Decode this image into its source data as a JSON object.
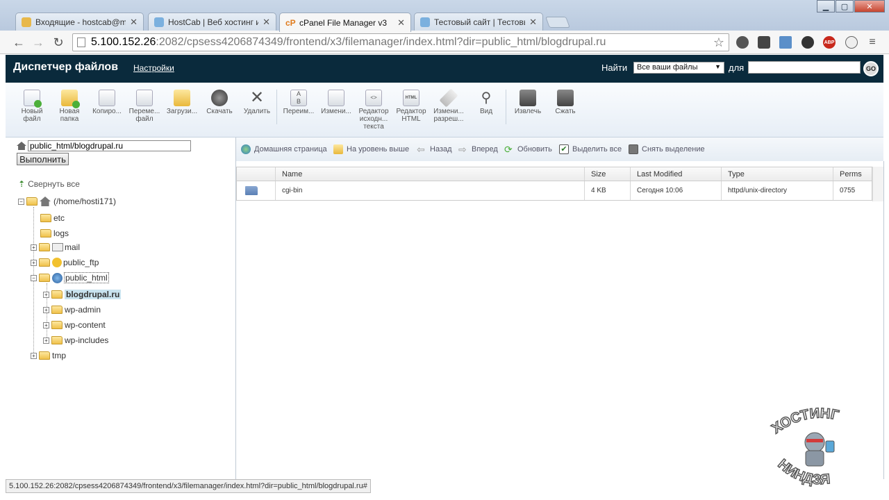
{
  "tabs": [
    {
      "label": "Входящие - hostcab@ma",
      "active": false
    },
    {
      "label": "HostCab | Веб хостинг и д",
      "active": false
    },
    {
      "label": "cPanel File Manager v3",
      "active": true
    },
    {
      "label": "Тестовый сайт | Тестовы",
      "active": false
    }
  ],
  "url": {
    "host": "5.100.152.26",
    "rest": ":2082/cpsess4206874349/frontend/x3/filemanager/index.html?dir=public_html/blogdrupal.ru"
  },
  "header": {
    "title": "Диспетчер файлов",
    "settings": "Настройки",
    "search_label": "Найти",
    "search_scope": "Все ваши файлы",
    "for_label": "для",
    "go": "GO"
  },
  "tools": [
    {
      "label": "Новый файл",
      "icon": "new-file-icon"
    },
    {
      "label": "Новая папка",
      "icon": "new-folder-icon"
    },
    {
      "label": "Копиро...",
      "icon": "copy-icon"
    },
    {
      "label": "Переме... файл",
      "icon": "move-icon"
    },
    {
      "label": "Загрузи...",
      "icon": "upload-icon"
    },
    {
      "label": "Скачать",
      "icon": "download-icon"
    },
    {
      "label": "Удалить",
      "icon": "delete-icon"
    },
    {
      "label": "Переим...",
      "icon": "rename-icon"
    },
    {
      "label": "Измени...",
      "icon": "edit-icon"
    },
    {
      "label": "Редактор исходн... текста",
      "icon": "code-editor-icon"
    },
    {
      "label": "Редактор HTML",
      "icon": "html-editor-icon"
    },
    {
      "label": "Измени... разреш...",
      "icon": "permissions-icon"
    },
    {
      "label": "Вид",
      "icon": "view-icon"
    },
    {
      "label": "Извлечь",
      "icon": "extract-icon"
    },
    {
      "label": "Сжать",
      "icon": "compress-icon"
    }
  ],
  "left": {
    "path_value": "public_html/blogdrupal.ru",
    "go_button": "Выполнить",
    "collapse_all": "Свернуть все",
    "home": "(/home/hosti171)",
    "tree": {
      "etc": "etc",
      "logs": "logs",
      "mail": "mail",
      "public_ftp": "public_ftp",
      "public_html": "public_html",
      "blogdrupal": "blogdrupal.ru",
      "wp_admin": "wp-admin",
      "wp_content": "wp-content",
      "wp_includes": "wp-includes",
      "tmp": "tmp"
    }
  },
  "nav": {
    "home": "Домашняя страница",
    "up": "На уровень выше",
    "back": "Назад",
    "forward": "Вперед",
    "refresh": "Обновить",
    "select_all": "Выделить все",
    "deselect": "Снять выделение"
  },
  "grid": {
    "headers": {
      "name": "Name",
      "size": "Size",
      "modified": "Last Modified",
      "type": "Type",
      "perms": "Perms"
    },
    "rows": [
      {
        "name": "cgi-bin",
        "size": "4 KB",
        "modified": "Сегодня 10:06",
        "type": "httpd/unix-directory",
        "perms": "0755"
      }
    ]
  },
  "status_url": "5.100.152.26:2082/cpsess4206874349/frontend/x3/filemanager/index.html?dir=public_html/blogdrupal.ru#",
  "watermark": {
    "top": "ХОСТИНГ",
    "bottom": "НИНДЗЯ"
  },
  "colors": {
    "header_bg": "#0a2a3c",
    "selected_bg": "#c9e3ef"
  }
}
